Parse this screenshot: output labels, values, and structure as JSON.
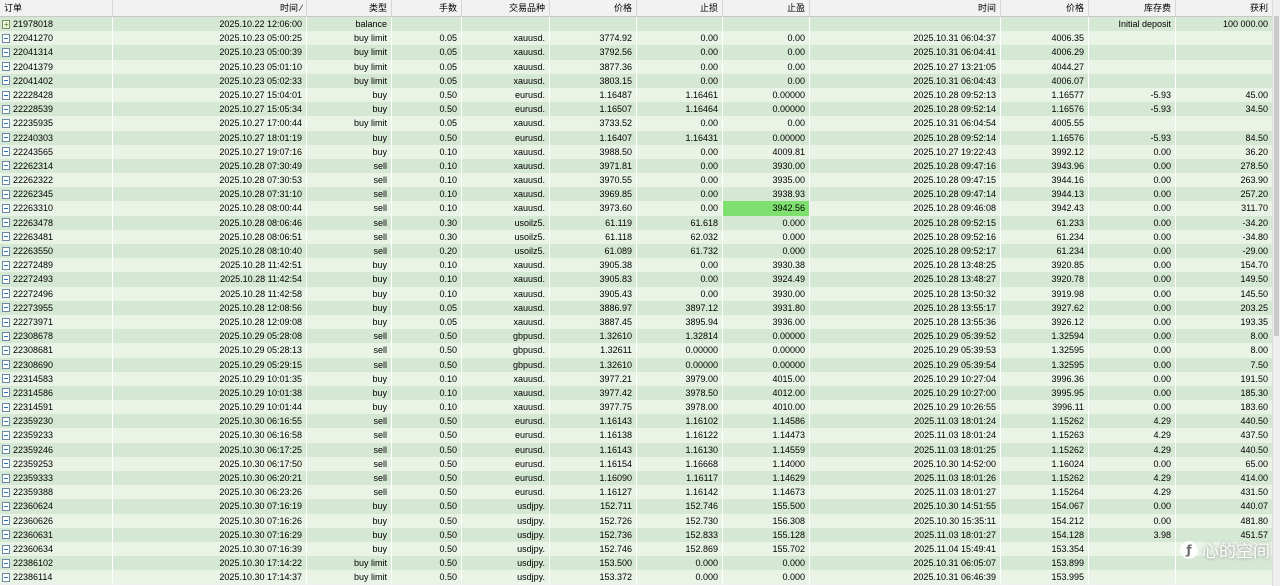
{
  "columns": [
    {
      "key": "order",
      "label": "订单",
      "w": 113,
      "align": "left"
    },
    {
      "key": "time",
      "label": "时间  ⁄",
      "w": 194
    },
    {
      "key": "type",
      "label": "类型",
      "w": 85
    },
    {
      "key": "lots",
      "label": "手数",
      "w": 70
    },
    {
      "key": "symbol",
      "label": "交易品种",
      "w": 88
    },
    {
      "key": "price",
      "label": "价格",
      "w": 87
    },
    {
      "key": "sl",
      "label": "止损",
      "w": 86
    },
    {
      "key": "tp",
      "label": "止盈",
      "w": 87
    },
    {
      "key": "close_time",
      "label": "时间",
      "w": 191
    },
    {
      "key": "close_price",
      "label": "价格",
      "w": 88
    },
    {
      "key": "swap",
      "label": "库存费",
      "w": 87
    },
    {
      "key": "profit",
      "label": "获利",
      "w": 97
    }
  ],
  "rows": [
    {
      "order": "21978018",
      "time": "2025.10.22 12:06:00",
      "type": "balance",
      "lots": "",
      "symbol": "",
      "price": "",
      "sl": "",
      "tp": "",
      "close_time": "",
      "close_price": "",
      "swap": "Initial deposit",
      "profit": "100 000.00"
    },
    {
      "order": "22041270",
      "time": "2025.10.23 05:00:25",
      "type": "buy limit",
      "lots": "0.05",
      "symbol": "xauusd.",
      "price": "3774.92",
      "sl": "0.00",
      "tp": "0.00",
      "close_time": "2025.10.31 06:04:37",
      "close_price": "4006.35",
      "swap": "",
      "profit": ""
    },
    {
      "order": "22041314",
      "time": "2025.10.23 05:00:39",
      "type": "buy limit",
      "lots": "0.05",
      "symbol": "xauusd.",
      "price": "3792.56",
      "sl": "0.00",
      "tp": "0.00",
      "close_time": "2025.10.31 06:04:41",
      "close_price": "4006.29",
      "swap": "",
      "profit": ""
    },
    {
      "order": "22041379",
      "time": "2025.10.23 05:01:10",
      "type": "buy limit",
      "lots": "0.05",
      "symbol": "xauusd.",
      "price": "3877.36",
      "sl": "0.00",
      "tp": "0.00",
      "close_time": "2025.10.27 13:21:05",
      "close_price": "4044.27",
      "swap": "",
      "profit": ""
    },
    {
      "order": "22041402",
      "time": "2025.10.23 05:02:33",
      "type": "buy limit",
      "lots": "0.05",
      "symbol": "xauusd.",
      "price": "3803.15",
      "sl": "0.00",
      "tp": "0.00",
      "close_time": "2025.10.31 06:04:43",
      "close_price": "4006.07",
      "swap": "",
      "profit": ""
    },
    {
      "order": "22228428",
      "time": "2025.10.27 15:04:01",
      "type": "buy",
      "lots": "0.50",
      "symbol": "eurusd.",
      "price": "1.16487",
      "sl": "1.16461",
      "tp": "0.00000",
      "close_time": "2025.10.28 09:52:13",
      "close_price": "1.16577",
      "swap": "-5.93",
      "profit": "45.00"
    },
    {
      "order": "22228539",
      "time": "2025.10.27 15:05:34",
      "type": "buy",
      "lots": "0.50",
      "symbol": "eurusd.",
      "price": "1.16507",
      "sl": "1.16464",
      "tp": "0.00000",
      "close_time": "2025.10.28 09:52:14",
      "close_price": "1.16576",
      "swap": "-5.93",
      "profit": "34.50"
    },
    {
      "order": "22235935",
      "time": "2025.10.27 17:00:44",
      "type": "buy limit",
      "lots": "0.05",
      "symbol": "xauusd.",
      "price": "3733.52",
      "sl": "0.00",
      "tp": "0.00",
      "close_time": "2025.10.31 06:04:54",
      "close_price": "4005.55",
      "swap": "",
      "profit": ""
    },
    {
      "order": "22240303",
      "time": "2025.10.27 18:01:19",
      "type": "buy",
      "lots": "0.50",
      "symbol": "eurusd.",
      "price": "1.16407",
      "sl": "1.16431",
      "tp": "0.00000",
      "close_time": "2025.10.28 09:52:14",
      "close_price": "1.16576",
      "swap": "-5.93",
      "profit": "84.50"
    },
    {
      "order": "22243565",
      "time": "2025.10.27 19:07:16",
      "type": "buy",
      "lots": "0.10",
      "symbol": "xauusd.",
      "price": "3988.50",
      "sl": "0.00",
      "tp": "4009.81",
      "close_time": "2025.10.27 19:22:43",
      "close_price": "3992.12",
      "swap": "0.00",
      "profit": "36.20"
    },
    {
      "order": "22262314",
      "time": "2025.10.28 07:30:49",
      "type": "sell",
      "lots": "0.10",
      "symbol": "xauusd.",
      "price": "3971.81",
      "sl": "0.00",
      "tp": "3930.00",
      "close_time": "2025.10.28 09:47:16",
      "close_price": "3943.96",
      "swap": "0.00",
      "profit": "278.50"
    },
    {
      "order": "22262322",
      "time": "2025.10.28 07:30:53",
      "type": "sell",
      "lots": "0.10",
      "symbol": "xauusd.",
      "price": "3970.55",
      "sl": "0.00",
      "tp": "3935.00",
      "close_time": "2025.10.28 09:47:15",
      "close_price": "3944.16",
      "swap": "0.00",
      "profit": "263.90"
    },
    {
      "order": "22262345",
      "time": "2025.10.28 07:31:10",
      "type": "sell",
      "lots": "0.10",
      "symbol": "xauusd.",
      "price": "3969.85",
      "sl": "0.00",
      "tp": "3938.93",
      "close_time": "2025.10.28 09:47:14",
      "close_price": "3944.13",
      "swap": "0.00",
      "profit": "257.20"
    },
    {
      "order": "22263310",
      "time": "2025.10.28 08:00:44",
      "type": "sell",
      "lots": "0.10",
      "symbol": "xauusd.",
      "price": "3973.60",
      "sl": "0.00",
      "tp": "3942.56",
      "close_time": "2025.10.28 09:46:08",
      "close_price": "3942.43",
      "swap": "0.00",
      "profit": "311.70",
      "highlight": "tp"
    },
    {
      "order": "22263478",
      "time": "2025.10.28 08:06:46",
      "type": "sell",
      "lots": "0.30",
      "symbol": "usoilz5.",
      "price": "61.119",
      "sl": "61.618",
      "tp": "0.000",
      "close_time": "2025.10.28 09:52:15",
      "close_price": "61.233",
      "swap": "0.00",
      "profit": "-34.20"
    },
    {
      "order": "22263481",
      "time": "2025.10.28 08:06:51",
      "type": "sell",
      "lots": "0.30",
      "symbol": "usoilz5.",
      "price": "61.118",
      "sl": "62.032",
      "tp": "0.000",
      "close_time": "2025.10.28 09:52:16",
      "close_price": "61.234",
      "swap": "0.00",
      "profit": "-34.80"
    },
    {
      "order": "22263550",
      "time": "2025.10.28 08:10:40",
      "type": "sell",
      "lots": "0.20",
      "symbol": "usoilz5.",
      "price": "61.089",
      "sl": "61.732",
      "tp": "0.000",
      "close_time": "2025.10.28 09:52:17",
      "close_price": "61.234",
      "swap": "0.00",
      "profit": "-29.00"
    },
    {
      "order": "22272489",
      "time": "2025.10.28 11:42:51",
      "type": "buy",
      "lots": "0.10",
      "symbol": "xauusd.",
      "price": "3905.38",
      "sl": "0.00",
      "tp": "3930.38",
      "close_time": "2025.10.28 13:48:25",
      "close_price": "3920.85",
      "swap": "0.00",
      "profit": "154.70"
    },
    {
      "order": "22272493",
      "time": "2025.10.28 11:42:54",
      "type": "buy",
      "lots": "0.10",
      "symbol": "xauusd.",
      "price": "3905.83",
      "sl": "0.00",
      "tp": "3924.49",
      "close_time": "2025.10.28 13:48:27",
      "close_price": "3920.78",
      "swap": "0.00",
      "profit": "149.50"
    },
    {
      "order": "22272496",
      "time": "2025.10.28 11:42:58",
      "type": "buy",
      "lots": "0.10",
      "symbol": "xauusd.",
      "price": "3905.43",
      "sl": "0.00",
      "tp": "3930.00",
      "close_time": "2025.10.28 13:50:32",
      "close_price": "3919.98",
      "swap": "0.00",
      "profit": "145.50"
    },
    {
      "order": "22273955",
      "time": "2025.10.28 12:08:56",
      "type": "buy",
      "lots": "0.05",
      "symbol": "xauusd.",
      "price": "3886.97",
      "sl": "3897.12",
      "tp": "3931.80",
      "close_time": "2025.10.28 13:55:17",
      "close_price": "3927.62",
      "swap": "0.00",
      "profit": "203.25"
    },
    {
      "order": "22273971",
      "time": "2025.10.28 12:09:08",
      "type": "buy",
      "lots": "0.05",
      "symbol": "xauusd.",
      "price": "3887.45",
      "sl": "3895.94",
      "tp": "3936.00",
      "close_time": "2025.10.28 13:55:36",
      "close_price": "3926.12",
      "swap": "0.00",
      "profit": "193.35"
    },
    {
      "order": "22308678",
      "time": "2025.10.29 05:28:08",
      "type": "sell",
      "lots": "0.50",
      "symbol": "gbpusd.",
      "price": "1.32610",
      "sl": "1.32814",
      "tp": "0.00000",
      "close_time": "2025.10.29 05:39:52",
      "close_price": "1.32594",
      "swap": "0.00",
      "profit": "8.00"
    },
    {
      "order": "22308681",
      "time": "2025.10.29 05:28:13",
      "type": "sell",
      "lots": "0.50",
      "symbol": "gbpusd.",
      "price": "1.32611",
      "sl": "0.00000",
      "tp": "0.00000",
      "close_time": "2025.10.29 05:39:53",
      "close_price": "1.32595",
      "swap": "0.00",
      "profit": "8.00"
    },
    {
      "order": "22308690",
      "time": "2025.10.29 05:29:15",
      "type": "sell",
      "lots": "0.50",
      "symbol": "gbpusd.",
      "price": "1.32610",
      "sl": "0.00000",
      "tp": "0.00000",
      "close_time": "2025.10.29 05:39:54",
      "close_price": "1.32595",
      "swap": "0.00",
      "profit": "7.50"
    },
    {
      "order": "22314583",
      "time": "2025.10.29 10:01:35",
      "type": "buy",
      "lots": "0.10",
      "symbol": "xauusd.",
      "price": "3977.21",
      "sl": "3979.00",
      "tp": "4015.00",
      "close_time": "2025.10.29 10:27:04",
      "close_price": "3996.36",
      "swap": "0.00",
      "profit": "191.50"
    },
    {
      "order": "22314586",
      "time": "2025.10.29 10:01:38",
      "type": "buy",
      "lots": "0.10",
      "symbol": "xauusd.",
      "price": "3977.42",
      "sl": "3978.50",
      "tp": "4012.00",
      "close_time": "2025.10.29 10:27:00",
      "close_price": "3995.95",
      "swap": "0.00",
      "profit": "185.30"
    },
    {
      "order": "22314591",
      "time": "2025.10.29 10:01:44",
      "type": "buy",
      "lots": "0.10",
      "symbol": "xauusd.",
      "price": "3977.75",
      "sl": "3978.00",
      "tp": "4010.00",
      "close_time": "2025.10.29 10:26:55",
      "close_price": "3996.11",
      "swap": "0.00",
      "profit": "183.60"
    },
    {
      "order": "22359230",
      "time": "2025.10.30 06:16:55",
      "type": "sell",
      "lots": "0.50",
      "symbol": "eurusd.",
      "price": "1.16143",
      "sl": "1.16102",
      "tp": "1.14586",
      "close_time": "2025.11.03 18:01:24",
      "close_price": "1.15262",
      "swap": "4.29",
      "profit": "440.50"
    },
    {
      "order": "22359233",
      "time": "2025.10.30 06:16:58",
      "type": "sell",
      "lots": "0.50",
      "symbol": "eurusd.",
      "price": "1.16138",
      "sl": "1.16122",
      "tp": "1.14473",
      "close_time": "2025.11.03 18:01:24",
      "close_price": "1.15263",
      "swap": "4.29",
      "profit": "437.50"
    },
    {
      "order": "22359246",
      "time": "2025.10.30 06:17:25",
      "type": "sell",
      "lots": "0.50",
      "symbol": "eurusd.",
      "price": "1.16143",
      "sl": "1.16130",
      "tp": "1.14559",
      "close_time": "2025.11.03 18:01:25",
      "close_price": "1.15262",
      "swap": "4.29",
      "profit": "440.50"
    },
    {
      "order": "22359253",
      "time": "2025.10.30 06:17:50",
      "type": "sell",
      "lots": "0.50",
      "symbol": "eurusd.",
      "price": "1.16154",
      "sl": "1.16668",
      "tp": "1.14000",
      "close_time": "2025.10.30 14:52:00",
      "close_price": "1.16024",
      "swap": "0.00",
      "profit": "65.00"
    },
    {
      "order": "22359333",
      "time": "2025.10.30 06:20:21",
      "type": "sell",
      "lots": "0.50",
      "symbol": "eurusd.",
      "price": "1.16090",
      "sl": "1.16117",
      "tp": "1.14629",
      "close_time": "2025.11.03 18:01:26",
      "close_price": "1.15262",
      "swap": "4.29",
      "profit": "414.00"
    },
    {
      "order": "22359388",
      "time": "2025.10.30 06:23:26",
      "type": "sell",
      "lots": "0.50",
      "symbol": "eurusd.",
      "price": "1.16127",
      "sl": "1.16142",
      "tp": "1.14673",
      "close_time": "2025.11.03 18:01:27",
      "close_price": "1.15264",
      "swap": "4.29",
      "profit": "431.50"
    },
    {
      "order": "22360624",
      "time": "2025.10.30 07:16:19",
      "type": "buy",
      "lots": "0.50",
      "symbol": "usdjpy.",
      "price": "152.711",
      "sl": "152.746",
      "tp": "155.500",
      "close_time": "2025.10.30 14:51:55",
      "close_price": "154.067",
      "swap": "0.00",
      "profit": "440.07"
    },
    {
      "order": "22360626",
      "time": "2025.10.30 07:16:26",
      "type": "buy",
      "lots": "0.50",
      "symbol": "usdjpy.",
      "price": "152.726",
      "sl": "152.730",
      "tp": "156.308",
      "close_time": "2025.10.30 15:35:11",
      "close_price": "154.212",
      "swap": "0.00",
      "profit": "481.80"
    },
    {
      "order": "22360631",
      "time": "2025.10.30 07:16:29",
      "type": "buy",
      "lots": "0.50",
      "symbol": "usdjpy.",
      "price": "152.736",
      "sl": "152.833",
      "tp": "155.128",
      "close_time": "2025.11.03 18:01:27",
      "close_price": "154.128",
      "swap": "3.98",
      "profit": "451.57"
    },
    {
      "order": "22360634",
      "time": "2025.10.30 07:16:39",
      "type": "buy",
      "lots": "0.50",
      "symbol": "usdjpy.",
      "price": "152.746",
      "sl": "152.869",
      "tp": "155.702",
      "close_time": "2025.11.04 15:49:41",
      "close_price": "153.354",
      "swap": "",
      "profit": ""
    },
    {
      "order": "22386102",
      "time": "2025.10.30 17:14:22",
      "type": "buy limit",
      "lots": "0.50",
      "symbol": "usdjpy.",
      "price": "153.500",
      "sl": "0.000",
      "tp": "0.000",
      "close_time": "2025.10.31 06:05:07",
      "close_price": "153.899",
      "swap": "",
      "profit": ""
    },
    {
      "order": "22386114",
      "time": "2025.10.30 17:14:37",
      "type": "buy limit",
      "lots": "0.50",
      "symbol": "usdjpy.",
      "price": "153.372",
      "sl": "0.000",
      "tp": "0.000",
      "close_time": "2025.10.31 06:46:39",
      "close_price": "153.995",
      "swap": "",
      "profit": ""
    }
  ],
  "watermark": {
    "text": "心的空间",
    "logo_icon": "f-logo-icon"
  },
  "colors": {
    "row_alt": "#d5e8d4",
    "row_even": "#e9f3e6",
    "highlight": "#7ee06e"
  }
}
